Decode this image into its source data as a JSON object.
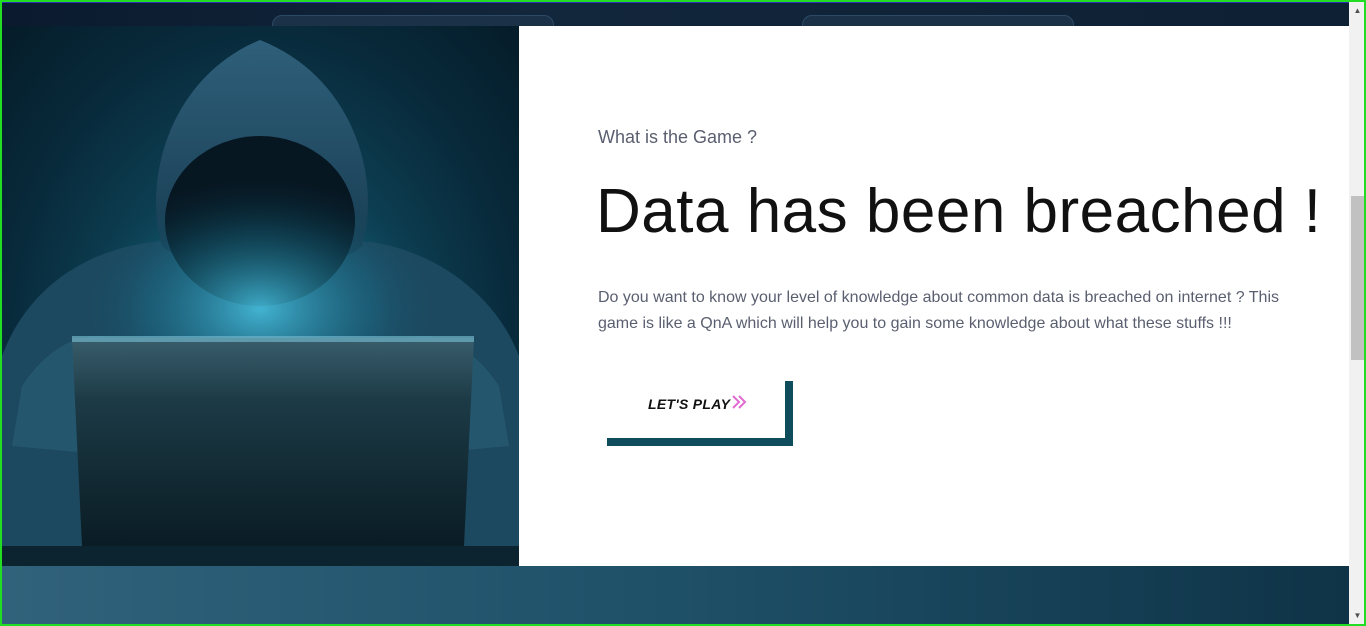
{
  "section": {
    "eyebrow": "What is the Game ?",
    "headline": "Data has been breached !",
    "description": "Do you want to know your level of knowledge about common data is breached on internet ? This game is like a QnA which will help you to gain some knowledge about what these stuffs !!!"
  },
  "cta": {
    "label": "LET'S PLAY",
    "icon": "double-chevron-right-icon",
    "accent_color": "#e26bd2",
    "frame_color": "#0f4c5c"
  },
  "hero_image": {
    "icon": "hooded-hacker-laptop-image"
  },
  "colors": {
    "band_start": "#31627b",
    "band_end": "#0f3347",
    "frame_border": "#22dd22"
  }
}
